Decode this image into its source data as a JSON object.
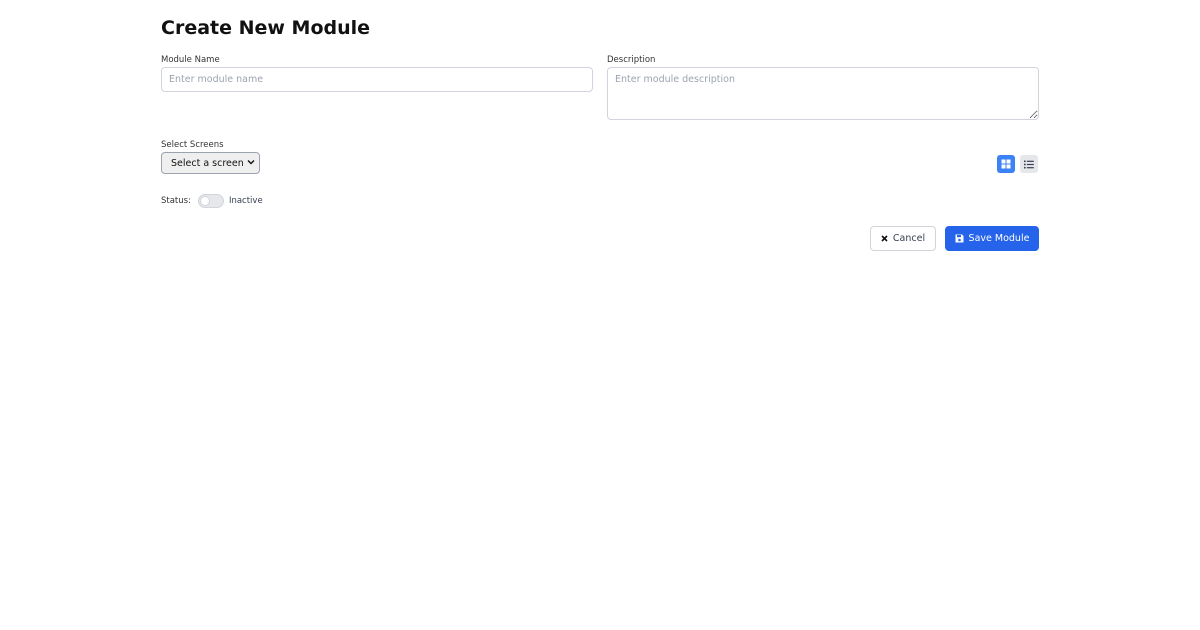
{
  "page": {
    "title": "Create New Module"
  },
  "form": {
    "module_name": {
      "label": "Module Name",
      "placeholder": "Enter module name",
      "value": ""
    },
    "description": {
      "label": "Description",
      "placeholder": "Enter module description",
      "value": ""
    },
    "screens": {
      "label": "Select Screens",
      "selected": "Select a screen"
    },
    "status": {
      "label": "Status:",
      "value": "Inactive",
      "enabled": false
    }
  },
  "view_toggle": {
    "active": "grid",
    "grid_icon": "grid-icon",
    "list_icon": "list-icon"
  },
  "actions": {
    "cancel_label": "Cancel",
    "cancel_icon": "close-icon",
    "save_label": "Save Module",
    "save_icon": "save-icon"
  },
  "colors": {
    "primary": "#2563eb",
    "view_active": "#3b82f6"
  }
}
